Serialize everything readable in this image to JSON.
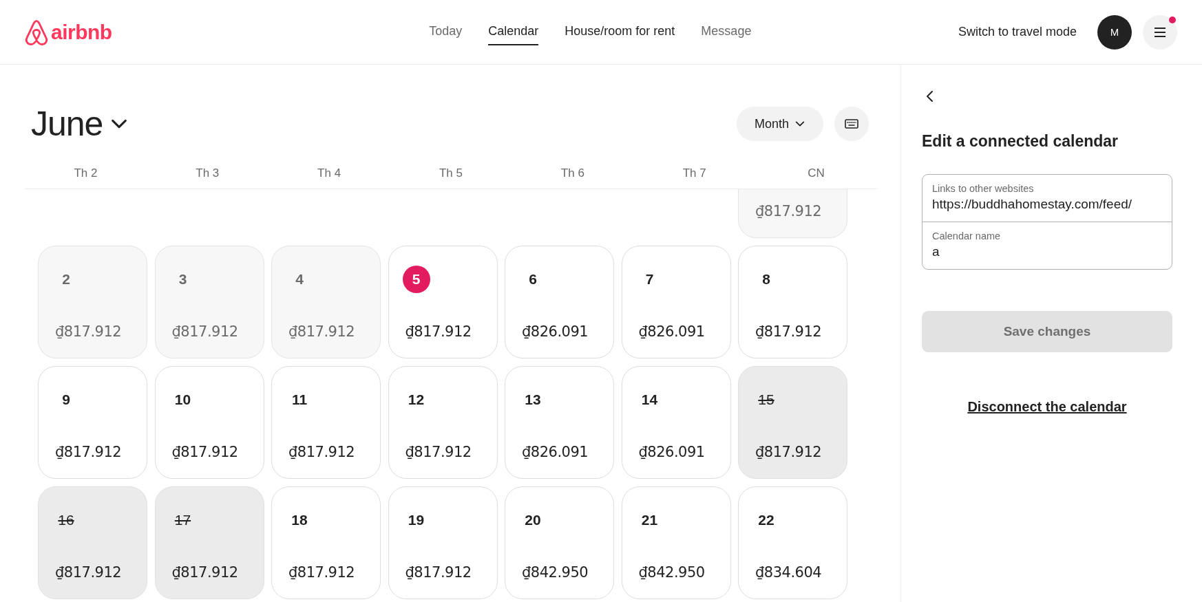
{
  "header": {
    "logo_text": "airbnb",
    "nav": [
      {
        "label": "Today",
        "selected": false
      },
      {
        "label": "Calendar",
        "selected": true
      },
      {
        "label": "House/room for rent",
        "selected": false,
        "emphasis": true
      },
      {
        "label": "Message",
        "selected": false
      }
    ],
    "travel_mode": "Switch to travel mode",
    "avatar_initial": "M",
    "menu_notification": true
  },
  "calendar": {
    "month": "June",
    "view": "Month",
    "weekdays": [
      "Th 2",
      "Th 3",
      "Th 4",
      "Th 5",
      "Th 6",
      "Th 7",
      "CN"
    ],
    "weeks": [
      {
        "partial": true,
        "days": [
          {
            "kind": "blank"
          },
          {
            "kind": "blank"
          },
          {
            "kind": "blank"
          },
          {
            "kind": "blank"
          },
          {
            "kind": "blank"
          },
          {
            "kind": "blank"
          },
          {
            "price": "₫817.912",
            "kind": "past"
          }
        ]
      },
      {
        "days": [
          {
            "day": "2",
            "price": "₫817.912",
            "kind": "past"
          },
          {
            "day": "3",
            "price": "₫817.912",
            "kind": "past"
          },
          {
            "day": "4",
            "price": "₫817.912",
            "kind": "past"
          },
          {
            "day": "5",
            "price": "₫817.912",
            "kind": "today"
          },
          {
            "day": "6",
            "price": "₫826.091",
            "kind": "available"
          },
          {
            "day": "7",
            "price": "₫826.091",
            "kind": "available"
          },
          {
            "day": "8",
            "price": "₫817.912",
            "kind": "available"
          }
        ]
      },
      {
        "days": [
          {
            "day": "9",
            "price": "₫817.912",
            "kind": "available"
          },
          {
            "day": "10",
            "price": "₫817.912",
            "kind": "available"
          },
          {
            "day": "11",
            "price": "₫817.912",
            "kind": "available"
          },
          {
            "day": "12",
            "price": "₫817.912",
            "kind": "available"
          },
          {
            "day": "13",
            "price": "₫826.091",
            "kind": "available"
          },
          {
            "day": "14",
            "price": "₫826.091",
            "kind": "available"
          },
          {
            "day": "15",
            "price": "₫817.912",
            "kind": "blocked"
          }
        ]
      },
      {
        "days": [
          {
            "day": "16",
            "price": "₫817.912",
            "kind": "blocked"
          },
          {
            "day": "17",
            "price": "₫817.912",
            "kind": "blocked"
          },
          {
            "day": "18",
            "price": "₫817.912",
            "kind": "available"
          },
          {
            "day": "19",
            "price": "₫817.912",
            "kind": "available"
          },
          {
            "day": "20",
            "price": "₫842.950",
            "kind": "available"
          },
          {
            "day": "21",
            "price": "₫842.950",
            "kind": "available"
          },
          {
            "day": "22",
            "price": "₫834.604",
            "kind": "available"
          }
        ]
      }
    ]
  },
  "panel": {
    "title": "Edit a connected calendar",
    "fields": [
      {
        "label": "Links to other websites",
        "value": "https://buddhahomestay.com/feed/"
      },
      {
        "label": "Calendar name",
        "value": "a"
      }
    ],
    "save_button": {
      "label": "Save changes",
      "disabled": true
    },
    "disconnect_link": "Disconnect the calendar"
  }
}
